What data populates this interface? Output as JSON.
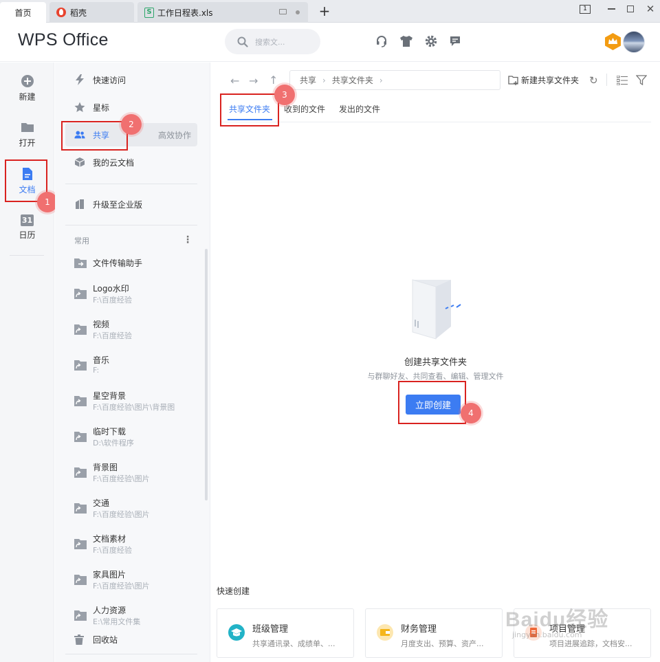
{
  "tabs": [
    {
      "label": "首页",
      "icon": "none"
    },
    {
      "label": "稻壳",
      "icon": "docer-icon"
    },
    {
      "label": "工作日程表.xls",
      "icon": "spreadsheet-icon"
    }
  ],
  "window_controls": {
    "page_indicator": "1"
  },
  "header": {
    "app_title": "WPS Office",
    "search_placeholder": "搜索文..."
  },
  "rail": {
    "items": [
      {
        "label": "新建",
        "icon": "plus-circle-icon"
      },
      {
        "label": "打开",
        "icon": "folder-icon"
      },
      {
        "label": "文档",
        "icon": "document-icon",
        "active": true
      },
      {
        "label": "日历",
        "icon": "calendar-icon",
        "glyph": "31"
      }
    ]
  },
  "nav": {
    "items": [
      {
        "label": "快速访问",
        "icon": "lightning-icon"
      },
      {
        "label": "星标",
        "icon": "star-icon"
      },
      {
        "label": "共享",
        "icon": "users-icon",
        "hint": "高效协作",
        "active": true
      },
      {
        "label": "我的云文档",
        "icon": "cloud-box-icon"
      }
    ],
    "upgrade_label": "升级至企业版",
    "section_label": "常用",
    "transfer_label": "文件传输助手",
    "files": [
      {
        "name": "Logo水印",
        "path": "F:\\百度经验"
      },
      {
        "name": "视频",
        "path": "F:\\百度经验"
      },
      {
        "name": "音乐",
        "path": "F:"
      },
      {
        "name": "星空背景",
        "path": "F:\\百度经验\\图片\\背景图"
      },
      {
        "name": "临时下载",
        "path": "D:\\软件程序"
      },
      {
        "name": "背景图",
        "path": "F:\\百度经验\\图片"
      },
      {
        "name": "交通",
        "path": "F:\\百度经验\\图片"
      },
      {
        "name": "文档素材",
        "path": "F:\\百度经验"
      },
      {
        "name": "家具图片",
        "path": "F:\\百度经验\\图片"
      },
      {
        "name": "人力资源",
        "path": "E:\\常用文件集"
      }
    ],
    "trash_label": "回收站"
  },
  "main": {
    "breadcrumb": [
      "共享",
      "共享文件夹"
    ],
    "new_shared_folder_label": "新建共享文件夹",
    "subtabs": [
      "共享文件夹",
      "收到的文件",
      "发出的文件"
    ],
    "empty_title": "创建共享文件夹",
    "empty_desc": "与群聊好友、共同查看、编辑、管理文件",
    "create_button": "立即创建",
    "quick_create_label": "快速创建",
    "quick_cards": [
      {
        "title": "班级管理",
        "desc": "共享通讯录、成绩单、...",
        "color": "#22b3c7"
      },
      {
        "title": "财务管理",
        "desc": "月度支出、预算、资产...",
        "color": "#f5b61b"
      },
      {
        "title": "项目管理",
        "desc": "项目进展追踪，文档安...",
        "color": "#ef6a3a"
      }
    ]
  },
  "annotations": [
    "1",
    "2",
    "3",
    "4"
  ],
  "watermark": {
    "text": "Baidu经验",
    "sub": "jingyan.baidu.com"
  },
  "colors": {
    "accent": "#3c7cf2",
    "highlight_red": "#d9221f",
    "badge": "#f07070",
    "tab_bg": "#e9ebef"
  }
}
